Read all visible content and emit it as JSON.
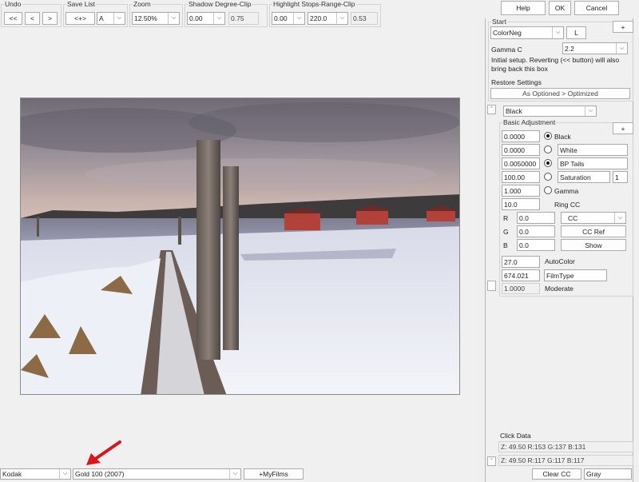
{
  "toolbar": {
    "undo": {
      "title": "Undo",
      "btn1": "<<",
      "btn2": "<",
      "btn3": ">"
    },
    "save_list": {
      "title": "Save List",
      "btn": "<+>",
      "value": "A"
    },
    "zoom": {
      "title": "Zoom",
      "value": "12.50%"
    },
    "shadow": {
      "title": "Shadow Degree-Clip",
      "value": "0.00",
      "readout": "0.75"
    },
    "highlight": {
      "title": "Highlight Stops-Range-Clip",
      "value1": "0.00",
      "value2": "220.0",
      "readout": "0.53"
    }
  },
  "actions": {
    "help": "Help",
    "ok": "OK",
    "cancel": "Cancel"
  },
  "start": {
    "title": "Start",
    "film_type": "ColorNeg",
    "l_button": "L",
    "gamma_label": "Gamma C",
    "gamma_value": "2.2",
    "info": "Initial setup. Reverting (<< button) will also bring back this box",
    "restore_label": "Restore Settings",
    "restore_value": "As Optioned > Optimized",
    "expand": "+"
  },
  "adjust_mode": "Black",
  "basic": {
    "title": "Basic Adjustment",
    "expand": "+",
    "black_value": "0.0000",
    "black_label": "Black",
    "white_value": "0.0000",
    "white_label": "White",
    "bp_value": "0.0050000",
    "bp_label": "BP Tails",
    "sat_value": "100.00",
    "sat_label": "Saturation",
    "sat_extra": "1",
    "gamma_value": "1.000",
    "gamma_label": "Gamma",
    "ring_value": "10.0",
    "ring_label": "Ring CC",
    "r_label": "R",
    "r_value": "0.0",
    "g_label": "G",
    "g_value": "0.0",
    "b_label": "B",
    "b_value": "0.0",
    "cc_select": "CC",
    "cc_ref": "CC Ref",
    "show": "Show",
    "autocolor_value": "27.0",
    "autocolor_label": "AutoColor",
    "filmtype_value": "674.021",
    "filmtype_label": "FilmType",
    "moderate_value": "1.0000",
    "moderate_label": "Moderate"
  },
  "click_data": {
    "title": "Click Data",
    "row1": "Z: 49.50 R:153 G:137 B:131",
    "row2": "Z: 49.50 R:117 G:117 B:117"
  },
  "bottom": {
    "brand": "Kodak",
    "film": "Gold 100 (2007)",
    "myfilms": "+MyFilms",
    "clear_cc": "Clear CC",
    "gray": "Gray"
  },
  "colors": {
    "annotation_arrow": "#d9171a"
  }
}
